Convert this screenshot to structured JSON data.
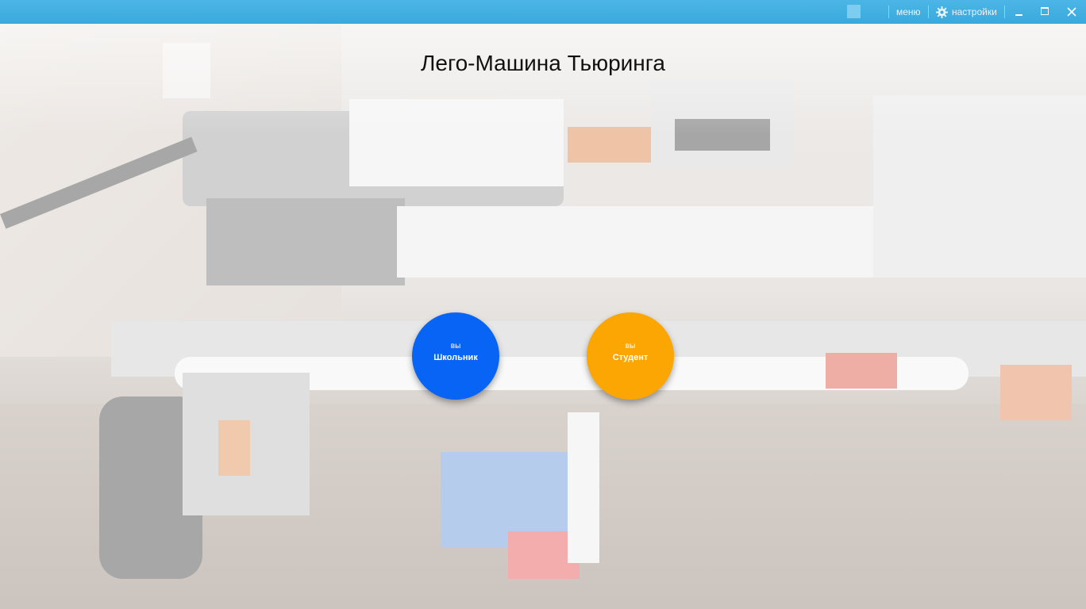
{
  "titlebar": {
    "menu_label": "меню",
    "settings_label": "настройки",
    "icons": [
      "app-square-icon",
      "gear-icon",
      "minimize-icon",
      "maximize-icon",
      "close-icon"
    ]
  },
  "main": {
    "title": "Лего-Машина Тьюринга",
    "roles": [
      {
        "prefix": "вы",
        "label": "Школьник",
        "color": "#0764f5"
      },
      {
        "prefix": "вы",
        "label": "Студент",
        "color": "#fba602"
      }
    ]
  },
  "colors": {
    "titlebar": "#3aa9dc",
    "school_button": "#0764f5",
    "student_button": "#fba602"
  }
}
